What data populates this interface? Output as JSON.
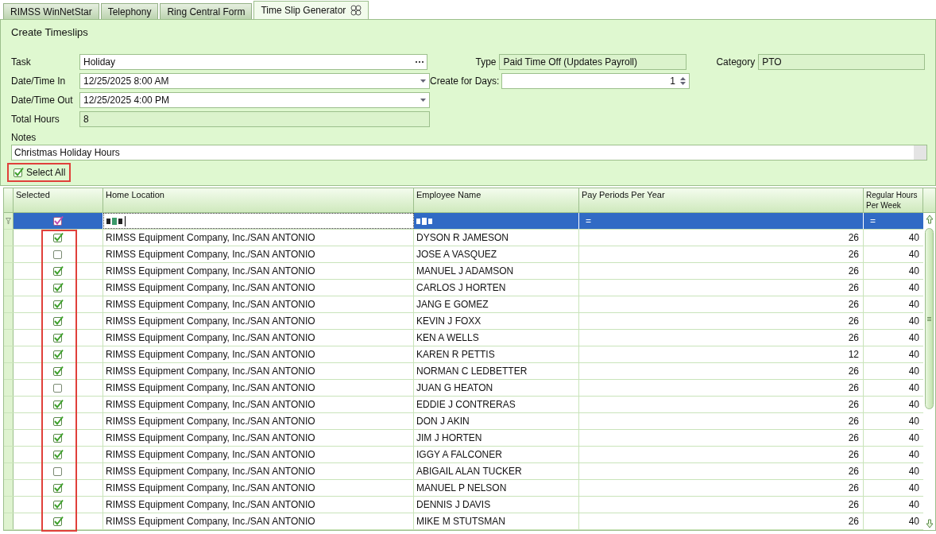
{
  "tabs": [
    {
      "label": "RIMSS WinNetStar",
      "selected": false
    },
    {
      "label": "Telephony",
      "selected": false
    },
    {
      "label": "Ring Central Form",
      "selected": false
    },
    {
      "label": "Time Slip Generator",
      "selected": true
    }
  ],
  "form": {
    "title": "Create Timeslips",
    "task": {
      "label": "Task",
      "value": "Holiday"
    },
    "date_in": {
      "label": "Date/Time In",
      "value": "12/25/2025 8:00 AM"
    },
    "date_out": {
      "label": "Date/Time Out",
      "value": "12/25/2025 4:00 PM"
    },
    "total_hours": {
      "label": "Total Hours",
      "value": "8"
    },
    "type": {
      "label": "Type",
      "value": "Paid Time Off (Updates Payroll)"
    },
    "category": {
      "label": "Category",
      "value": "PTO"
    },
    "create_for_days": {
      "label": "Create for Days:",
      "value": "1"
    },
    "notes": {
      "label": "Notes",
      "value": "Christmas Holiday Hours"
    },
    "select_all": {
      "label": "Select All",
      "highlighted": true
    }
  },
  "grid": {
    "columns": [
      "Selected",
      "Home Location",
      "Employee Name",
      "Pay Periods Per Year",
      "Regular Hours Per Week"
    ],
    "selected_column_highlighted": true,
    "filter": {
      "checked": true,
      "pay_op": "=",
      "hours_op": "="
    },
    "rows": [
      {
        "selected": true,
        "location": "RIMSS Equipment Company, Inc./SAN ANTONIO",
        "name": "DYSON R JAMESON",
        "pay_periods": "26",
        "hours": "40"
      },
      {
        "selected": false,
        "location": "RIMSS Equipment Company, Inc./SAN ANTONIO",
        "name": "JOSE A VASQUEZ",
        "pay_periods": "26",
        "hours": "40"
      },
      {
        "selected": true,
        "location": "RIMSS Equipment Company, Inc./SAN ANTONIO",
        "name": "MANUEL J ADAMSON",
        "pay_periods": "26",
        "hours": "40"
      },
      {
        "selected": true,
        "location": "RIMSS Equipment Company, Inc./SAN ANTONIO",
        "name": "CARLOS J HORTEN",
        "pay_periods": "26",
        "hours": "40"
      },
      {
        "selected": true,
        "location": "RIMSS Equipment Company, Inc./SAN ANTONIO",
        "name": "JANG E GOMEZ",
        "pay_periods": "26",
        "hours": "40"
      },
      {
        "selected": true,
        "location": "RIMSS Equipment Company, Inc./SAN ANTONIO",
        "name": "KEVIN J FOXX",
        "pay_periods": "26",
        "hours": "40"
      },
      {
        "selected": true,
        "location": "RIMSS Equipment Company, Inc./SAN ANTONIO",
        "name": "KEN A WELLS",
        "pay_periods": "26",
        "hours": "40"
      },
      {
        "selected": true,
        "location": "RIMSS Equipment Company, Inc./SAN ANTONIO",
        "name": "KAREN R PETTIS",
        "pay_periods": "12",
        "hours": "40"
      },
      {
        "selected": true,
        "location": "RIMSS Equipment Company, Inc./SAN ANTONIO",
        "name": "NORMAN C LEDBETTER",
        "pay_periods": "26",
        "hours": "40"
      },
      {
        "selected": false,
        "location": "RIMSS Equipment Company, Inc./SAN ANTONIO",
        "name": "JUAN G HEATON",
        "pay_periods": "26",
        "hours": "40"
      },
      {
        "selected": true,
        "location": "RIMSS Equipment Company, Inc./SAN ANTONIO",
        "name": "EDDIE J CONTRERAS",
        "pay_periods": "26",
        "hours": "40"
      },
      {
        "selected": true,
        "location": "RIMSS Equipment Company, Inc./SAN ANTONIO",
        "name": "DON J AKIN",
        "pay_periods": "26",
        "hours": "40"
      },
      {
        "selected": true,
        "location": "RIMSS Equipment Company, Inc./SAN ANTONIO",
        "name": "JIM J HORTEN",
        "pay_periods": "26",
        "hours": "40"
      },
      {
        "selected": true,
        "location": "RIMSS Equipment Company, Inc./SAN ANTONIO",
        "name": "IGGY A FALCONER",
        "pay_periods": "26",
        "hours": "40"
      },
      {
        "selected": false,
        "location": "RIMSS Equipment Company, Inc./SAN ANTONIO",
        "name": "ABIGAIL ALAN TUCKER",
        "pay_periods": "26",
        "hours": "40"
      },
      {
        "selected": true,
        "location": "RIMSS Equipment Company, Inc./SAN ANTONIO",
        "name": "MANUEL P NELSON",
        "pay_periods": "26",
        "hours": "40"
      },
      {
        "selected": true,
        "location": "RIMSS Equipment Company, Inc./SAN ANTONIO",
        "name": "DENNIS J DAVIS",
        "pay_periods": "26",
        "hours": "40"
      },
      {
        "selected": true,
        "location": "RIMSS Equipment Company, Inc./SAN ANTONIO",
        "name": "MIKE M STUTSMAN",
        "pay_periods": "26",
        "hours": "40"
      }
    ]
  }
}
